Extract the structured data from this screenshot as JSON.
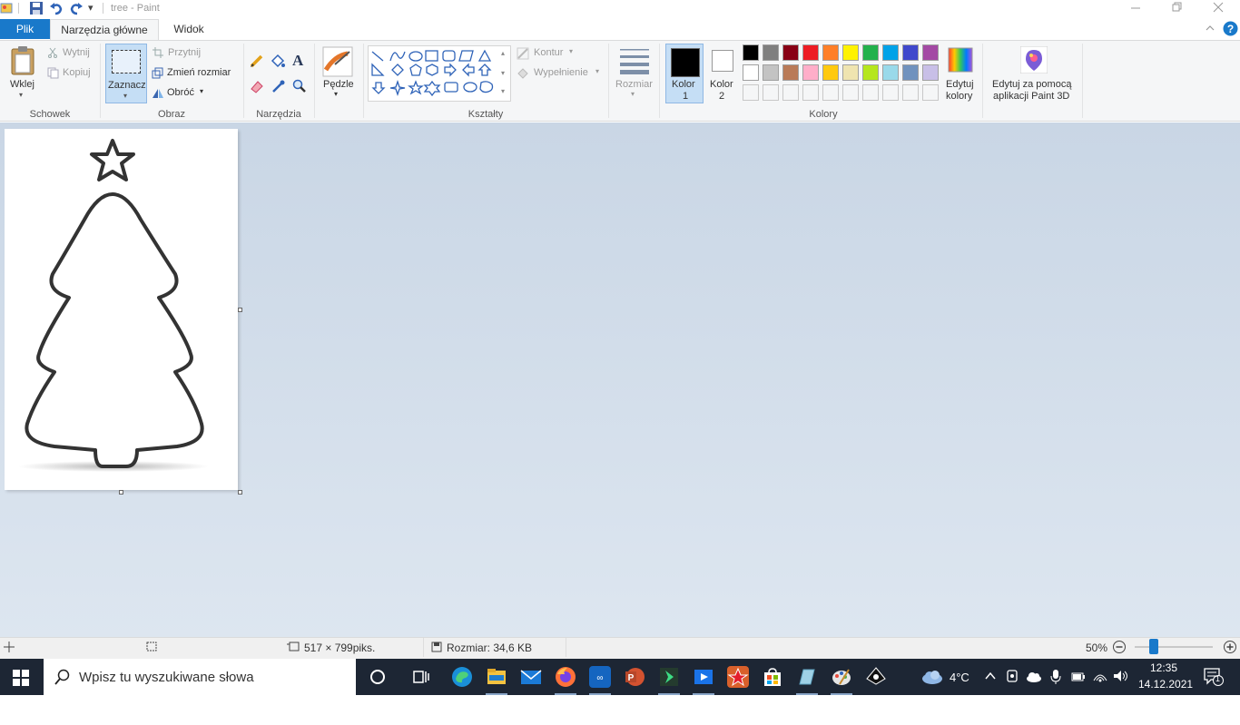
{
  "window": {
    "title": "tree - Paint",
    "qat_dropdown": "▾"
  },
  "tabs": {
    "file": "Plik",
    "home": "Narzędzia główne",
    "view": "Widok"
  },
  "ribbon": {
    "clipboard": {
      "paste": "Wklej",
      "cut": "Wytnij",
      "copy": "Kopiuj",
      "label": "Schowek"
    },
    "image": {
      "select": "Zaznacz",
      "crop": "Przytnij",
      "resize": "Zmień rozmiar",
      "rotate": "Obróć",
      "label": "Obraz"
    },
    "tools": {
      "label": "Narzędzia",
      "text_icon": "A"
    },
    "brushes": {
      "label": "Pędzle"
    },
    "shapes": {
      "outline": "Kontur",
      "fill": "Wypełnienie",
      "label": "Kształty"
    },
    "size": {
      "label": "Rozmiar"
    },
    "colors": {
      "color1": "Kolor",
      "color1_num": "1",
      "color2": "Kolor",
      "color2_num": "2",
      "edit1": "Edytuj",
      "edit2": "kolory",
      "label": "Kolory",
      "row1": [
        "#000000",
        "#7f7f7f",
        "#880015",
        "#ed1c24",
        "#ff7f27",
        "#fff200",
        "#22b14c",
        "#00a2e8",
        "#3f48cc",
        "#a349a4"
      ],
      "row2": [
        "#ffffff",
        "#c3c3c3",
        "#b97a57",
        "#ffaec9",
        "#ffc90e",
        "#efe4b0",
        "#b5e61d",
        "#99d9ea",
        "#7092be",
        "#c8bfe7"
      ]
    },
    "paint3d": {
      "line1": "Edytuj za pomocą",
      "line2": "aplikacji Paint 3D"
    }
  },
  "status": {
    "dimensions": "517 × 799piks.",
    "filesize": "Rozmiar: 34,6 KB",
    "zoom": "50%"
  },
  "taskbar": {
    "search_placeholder": "Wpisz tu wyszukiwane słowa",
    "weather": "4°C",
    "time": "12:35",
    "date": "14.12.2021",
    "notif_count": "1"
  }
}
